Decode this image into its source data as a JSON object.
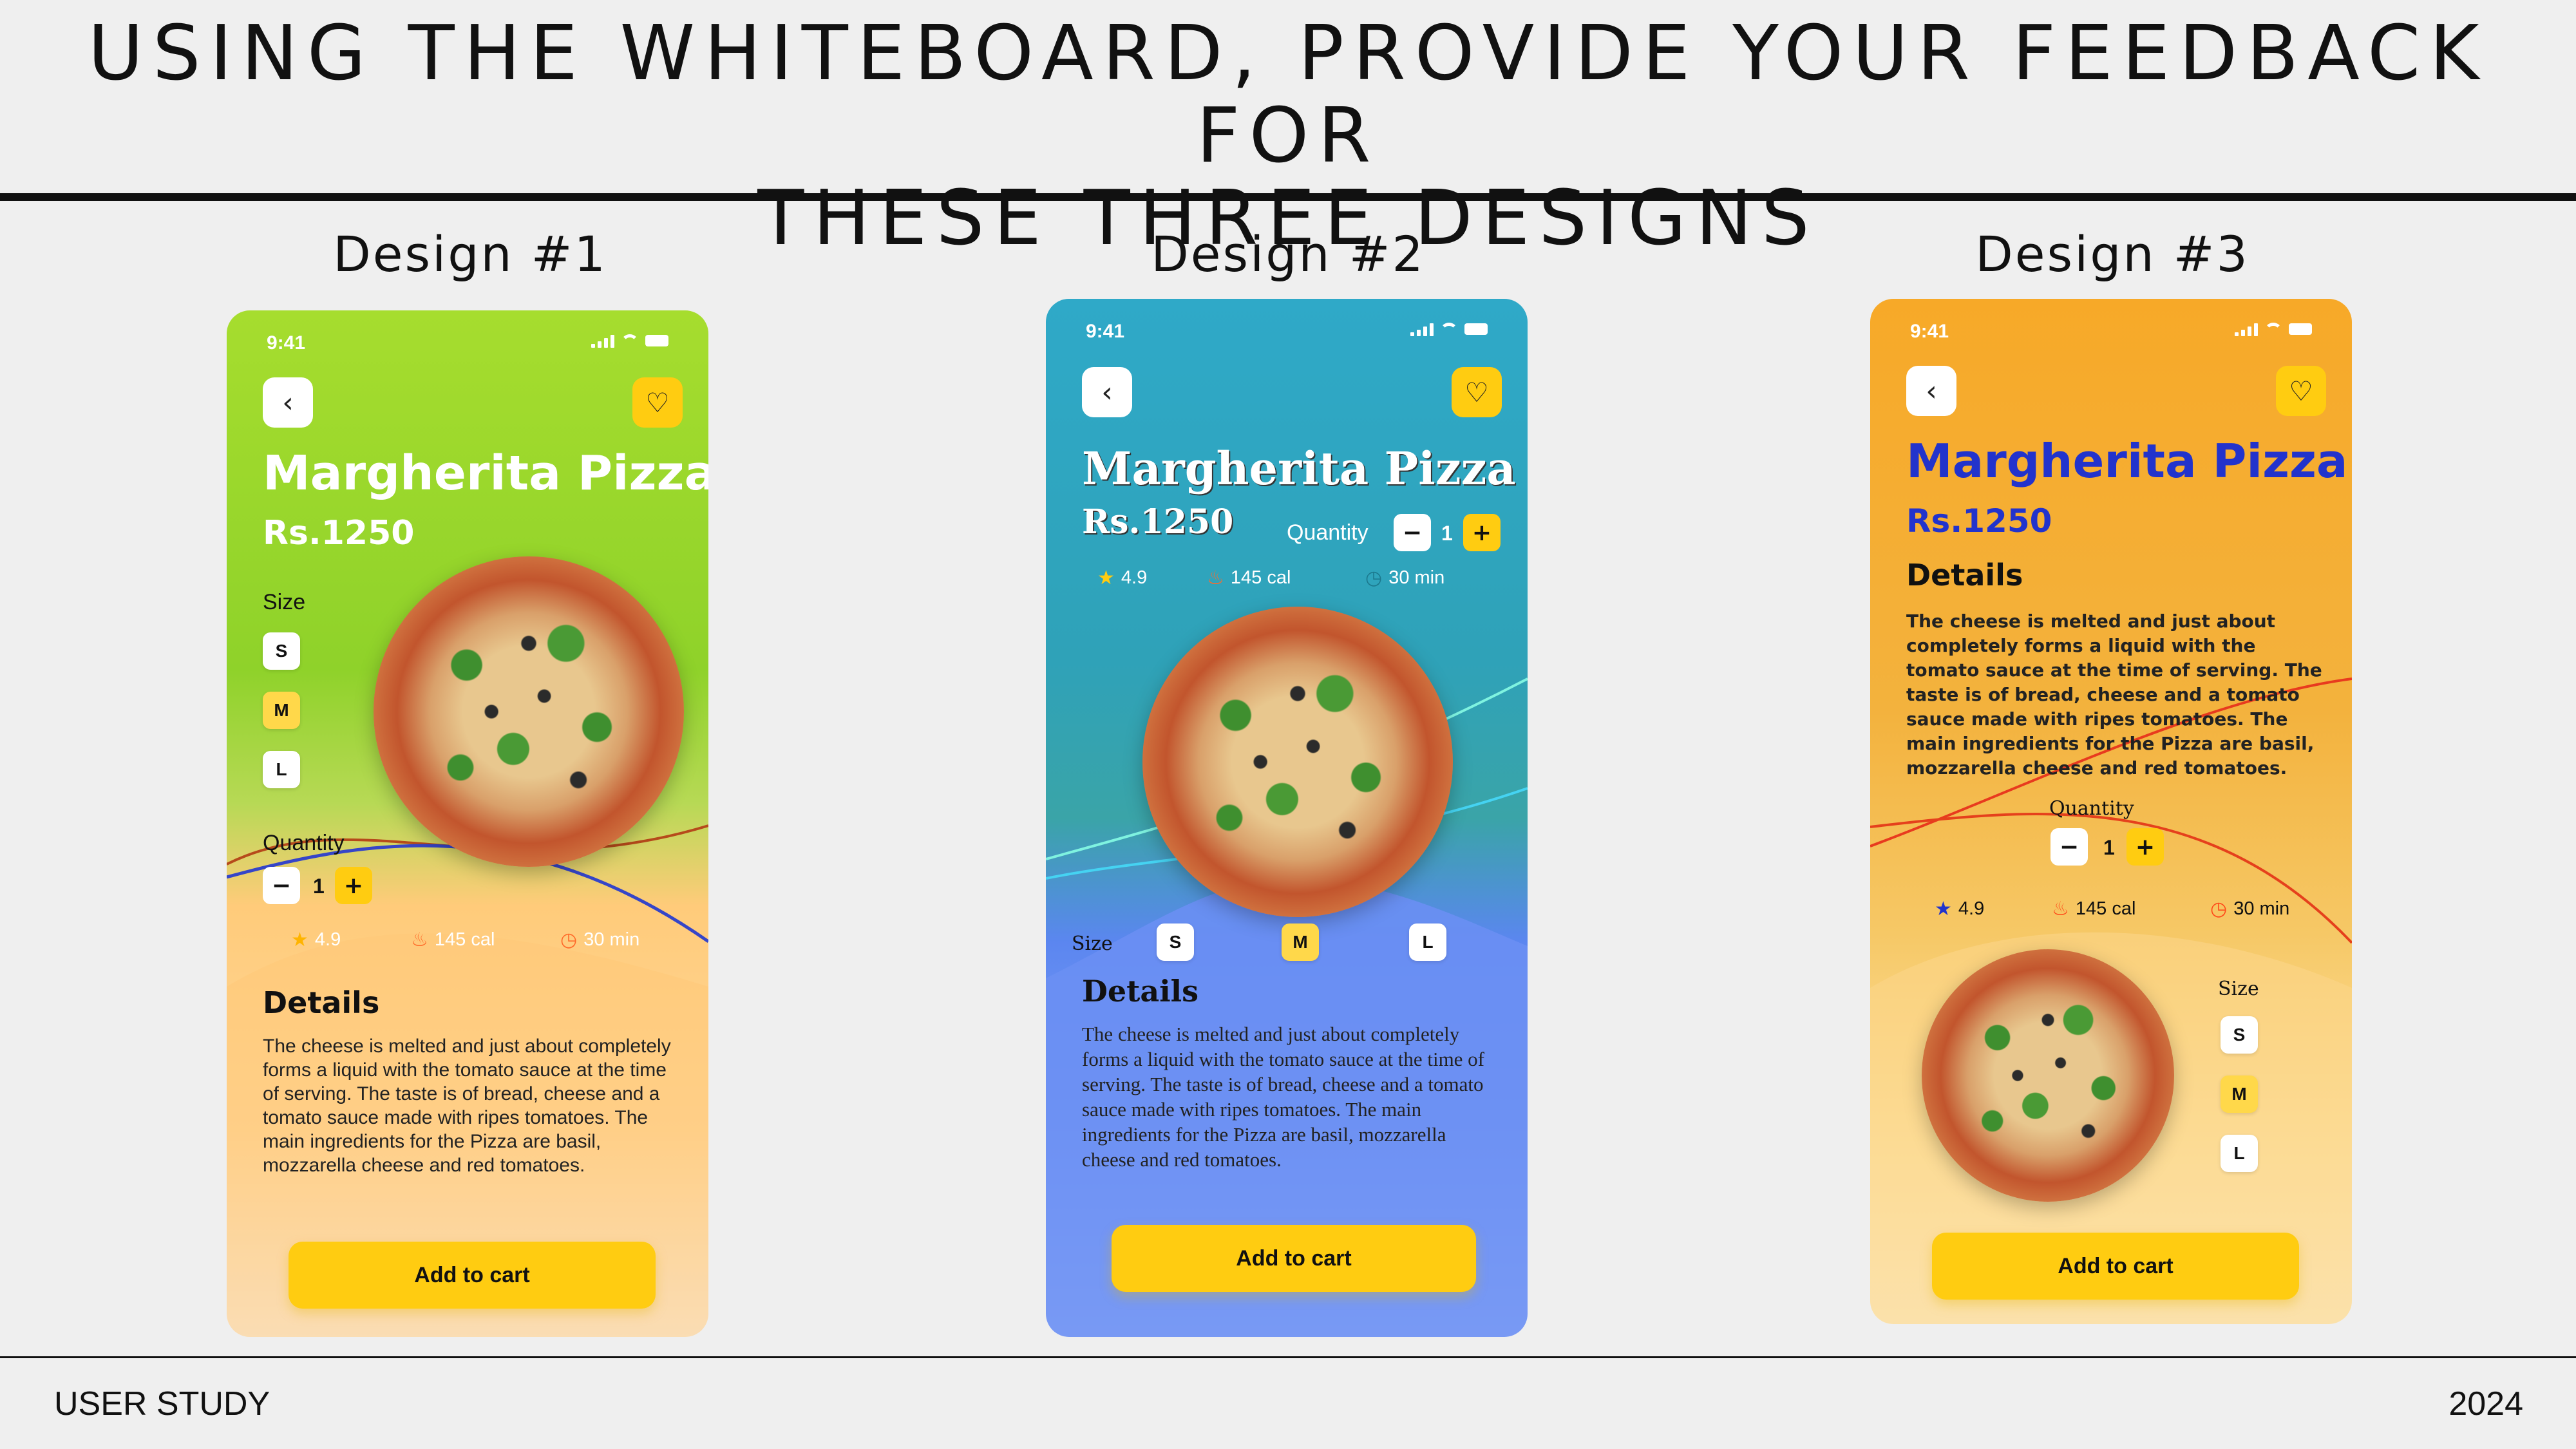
{
  "slide": {
    "title_line1": "USING THE WHITEBOARD, PROVIDE YOUR FEEDBACK FOR",
    "title_line2": "THESE THREE DESIGNS",
    "footer_left": "USER STUDY",
    "footer_right": "2024"
  },
  "designs": [
    {
      "label": "Design #1",
      "time": "9:41",
      "product": "Margherita Pizza",
      "price": "Rs.1250",
      "size_label": "Size",
      "sizes": [
        "S",
        "M",
        "L"
      ],
      "selected_size": "M",
      "quantity_label": "Quantity",
      "quantity": "1",
      "rating": "4.9",
      "calories": "145 cal",
      "time_to_cook": "30 min",
      "details_title": "Details",
      "details_text": "The cheese is melted and just about completely forms a liquid with the tomato sauce at the time of serving. The taste is of bread, cheese and a tomato sauce made with ripes tomatoes. The main ingredients for the Pizza are basil, mozzarella cheese and red tomatoes.",
      "cta": "Add to cart",
      "colors": {
        "top": "#9ed62a",
        "bottom": "#ffc46b",
        "title": "#ffffff"
      }
    },
    {
      "label": "Design #2",
      "time": "9:41",
      "product": "Margherita Pizza",
      "price": "Rs.1250",
      "size_label": "Size",
      "sizes": [
        "S",
        "M",
        "L"
      ],
      "selected_size": "M",
      "quantity_label": "Quantity",
      "quantity": "1",
      "rating": "4.9",
      "calories": "145 cal",
      "time_to_cook": "30 min",
      "details_title": "Details",
      "details_text": "The cheese is melted and just about completely forms a liquid with the tomato sauce at the time of serving. The taste is of bread, cheese and a tomato sauce made with ripes tomatoes. The main ingredients for the Pizza are basil, mozzarella cheese and red tomatoes.",
      "cta": "Add to cart",
      "colors": {
        "top": "#2aa6c4",
        "bottom": "#6e8ff4",
        "title": "#ffffff"
      }
    },
    {
      "label": "Design #3",
      "time": "9:41",
      "product": "Margherita Pizza",
      "price": "Rs.1250",
      "size_label": "Size",
      "sizes": [
        "S",
        "M",
        "L"
      ],
      "selected_size": "M",
      "quantity_label": "Quantity",
      "quantity": "1",
      "rating": "4.9",
      "calories": "145 cal",
      "time_to_cook": "30 min",
      "details_title": "Details",
      "details_text": "The cheese is melted and just about completely forms a liquid with the tomato sauce at the time of serving. The taste is of bread, cheese and a tomato sauce made with ripes tomatoes. The main ingredients for the Pizza are basil, mozzarella cheese and red tomatoes.",
      "cta": "Add to cart",
      "colors": {
        "top": "#f5a623",
        "bottom": "#fff1c9",
        "title": "#2233cc"
      }
    }
  ]
}
